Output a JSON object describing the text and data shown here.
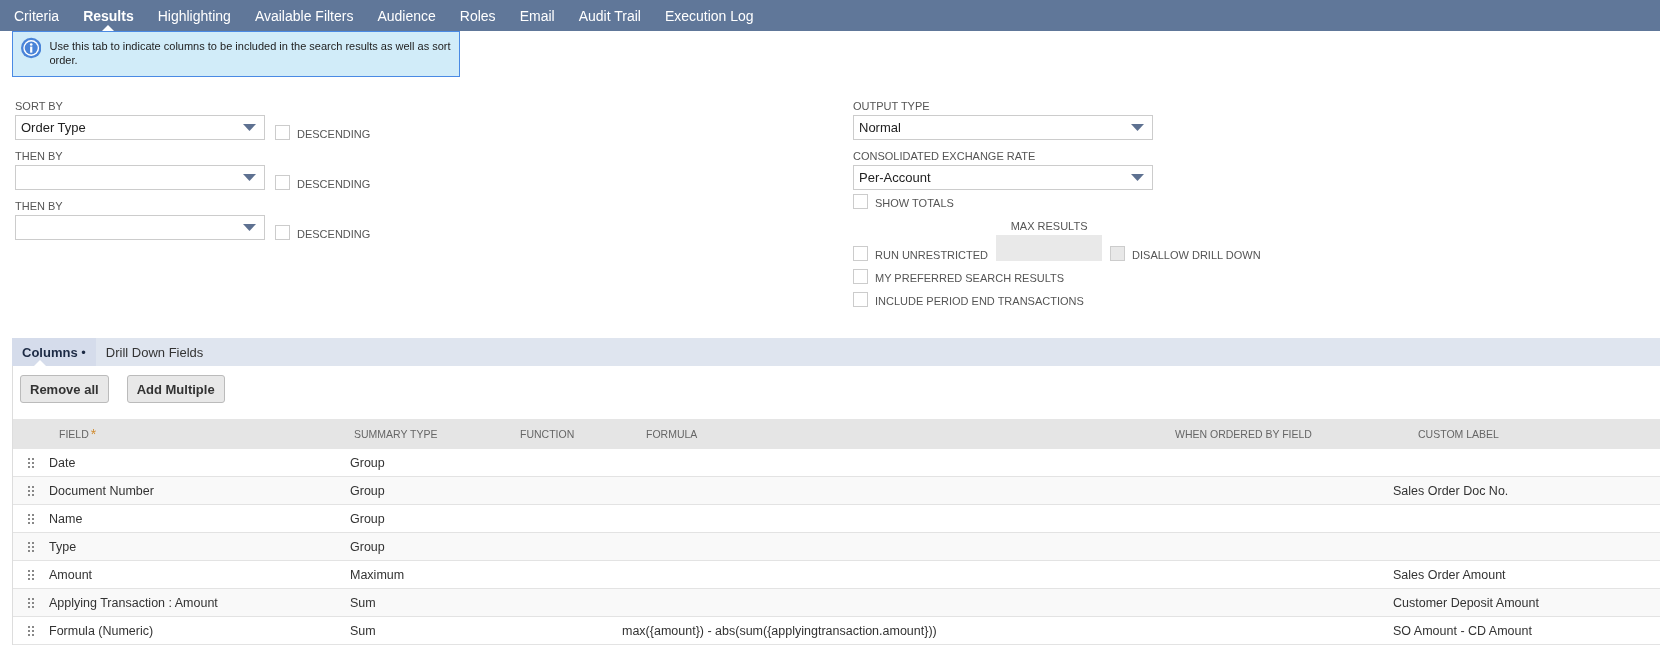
{
  "tabs": [
    {
      "label": "Criteria",
      "selected": false
    },
    {
      "label": "Results",
      "selected": true
    },
    {
      "label": "Highlighting",
      "selected": false
    },
    {
      "label": "Available Filters",
      "selected": false
    },
    {
      "label": "Audience",
      "selected": false
    },
    {
      "label": "Roles",
      "selected": false
    },
    {
      "label": "Email",
      "selected": false
    },
    {
      "label": "Audit Trail",
      "selected": false
    },
    {
      "label": "Execution Log",
      "selected": false
    }
  ],
  "info": {
    "text": "Use this tab to indicate columns to be included in the search results as well as sort order."
  },
  "sort": [
    {
      "label": "SORT BY",
      "value": "Order Type",
      "descending_label": "DESCENDING",
      "descending": false
    },
    {
      "label": "THEN BY",
      "descending_label": "DESCENDING",
      "descending": false
    },
    {
      "label": "THEN BY",
      "descending_label": "DESCENDING",
      "descending": false
    }
  ],
  "output_type": {
    "label": "OUTPUT TYPE",
    "value": "Normal"
  },
  "exchange_rate": {
    "label": "CONSOLIDATED EXCHANGE RATE",
    "value": "Per-Account"
  },
  "show_totals": {
    "label": "SHOW TOTALS",
    "checked": false
  },
  "max_results": {
    "label": "MAX RESULTS",
    "disabled": true
  },
  "run_unrestricted": {
    "label": "RUN UNRESTRICTED",
    "checked": false
  },
  "disallow_drill_down": {
    "label": "DISALLOW DRILL DOWN",
    "checked": false,
    "disabled": true
  },
  "my_preferred_search_results": {
    "label": "MY PREFERRED SEARCH RESULTS",
    "checked": false
  },
  "include_period_end_transactions": {
    "label": "INCLUDE PERIOD END TRANSACTIONS",
    "checked": false
  },
  "subtabs": [
    {
      "label": "Columns",
      "indicator": "•",
      "selected": true
    },
    {
      "label": "Drill Down Fields",
      "selected": false
    }
  ],
  "buttons": [
    "Remove all",
    "Add Multiple"
  ],
  "table": {
    "columns": [
      {
        "label": "FIELD",
        "required_mark": "*"
      },
      {
        "label": "SUMMARY TYPE"
      },
      {
        "label": "FUNCTION"
      },
      {
        "label": "FORMULA"
      },
      {
        "label": "WHEN ORDERED BY FIELD"
      },
      {
        "label": "CUSTOM LABEL"
      }
    ],
    "rows": [
      {
        "field": "Date",
        "summary_type": "Group"
      },
      {
        "field": "Document Number",
        "summary_type": "Group",
        "custom_label": "Sales Order Doc No."
      },
      {
        "field": "Name",
        "summary_type": "Group"
      },
      {
        "field": "Type",
        "summary_type": "Group"
      },
      {
        "field": "Amount",
        "summary_type": "Maximum",
        "custom_label": "Sales Order Amount"
      },
      {
        "field": "Applying Transaction : Amount",
        "summary_type": "Sum",
        "custom_label": "Customer Deposit Amount"
      },
      {
        "field": "Formula (Numeric)",
        "summary_type": "Sum",
        "formula": "max({amount}) - abs(sum({applyingtransaction.amount}))",
        "custom_label": "SO Amount - CD Amount"
      }
    ]
  }
}
